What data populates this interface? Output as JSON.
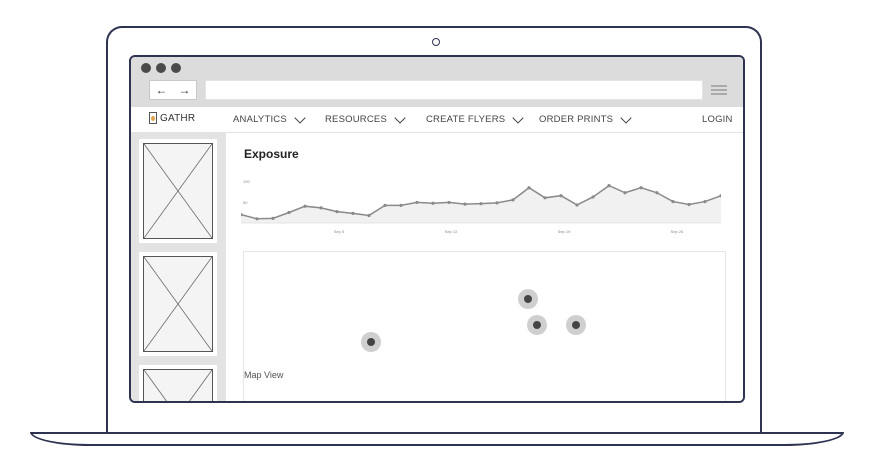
{
  "browser": {
    "back_glyph": "←",
    "forward_glyph": "→",
    "url": ""
  },
  "site_nav": {
    "logo": "GATHR",
    "items": [
      {
        "label": "ANALYTICS"
      },
      {
        "label": "RESOURCES"
      },
      {
        "label": "CREATE FLYERS"
      },
      {
        "label": "ORDER PRINTS"
      }
    ],
    "login": "LOGIN"
  },
  "main": {
    "title": "Exposure",
    "map_label": "Map View"
  },
  "chart_data": {
    "type": "area",
    "title": "Exposure",
    "ylim": [
      0,
      100
    ],
    "yticks": [
      "100",
      "50"
    ],
    "xticks": [
      "Sep 5",
      "Sep 12",
      "Sep 19",
      "Sep 26"
    ],
    "series": [
      {
        "values": [
          20,
          10,
          11,
          25,
          40,
          36,
          27,
          23,
          18,
          42,
          42,
          49,
          47,
          49,
          45,
          46,
          48,
          55,
          84,
          60,
          65,
          43,
          62,
          89,
          72,
          84,
          72,
          51,
          44,
          51,
          65
        ]
      }
    ],
    "grid": false
  },
  "colors": {
    "frame": "#2f3352",
    "chart_line": "#8a8a8a",
    "chart_fill": "#f1f1f1",
    "pin": "#444444"
  }
}
